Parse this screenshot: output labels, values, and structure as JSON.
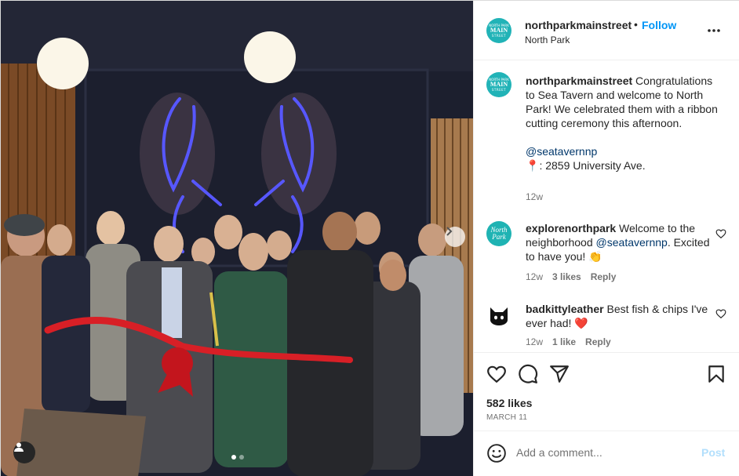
{
  "post": {
    "username": "northparkmainstreet",
    "follow_label": "Follow",
    "location": "North Park",
    "avatar_text": [
      "NORTH PARK",
      "MAIN",
      "STREET"
    ]
  },
  "caption": {
    "username": "northparkmainstreet",
    "text": "Congratulations to Sea Tavern and welcome to North Park! We celebrated them with a ribbon cutting ceremony this afternoon.",
    "mention": "@seatavernnp",
    "pin_emoji": "📍",
    "address": ": 2859 University Ave.",
    "time": "12w"
  },
  "comments": [
    {
      "username": "explorenorthpark",
      "avatar_text": "North Park",
      "text_before": "Welcome to the neighborhood ",
      "mention": "@seatavernnp",
      "text_after": ". Excited to have you! ",
      "emoji": "👏",
      "time": "12w",
      "likes": "3 likes",
      "reply": "Reply"
    },
    {
      "username": "badkittyleather",
      "text": "Best fish & chips I've ever had! ",
      "emoji": "❤️",
      "time": "12w",
      "likes": "1 like",
      "reply": "Reply"
    }
  ],
  "likes_count": "582 likes",
  "date": "MARCH 11",
  "add_comment": {
    "placeholder": "Add a comment...",
    "post_label": "Post"
  },
  "carousel": {
    "slide_count": 2,
    "active_index": 0
  },
  "icons": [
    "more-options-icon",
    "heart-icon",
    "comment-icon",
    "share-icon",
    "bookmark-icon",
    "emoji-icon",
    "user-tag-icon",
    "chevron-right-icon"
  ],
  "colors": {
    "accent": "#0095f6",
    "brand_teal": "#21b3b7",
    "muted": "#737373",
    "post_disabled": "#b2dffc",
    "ribbon_red": "#d81f26",
    "neon_blue": "#4b4bff"
  }
}
